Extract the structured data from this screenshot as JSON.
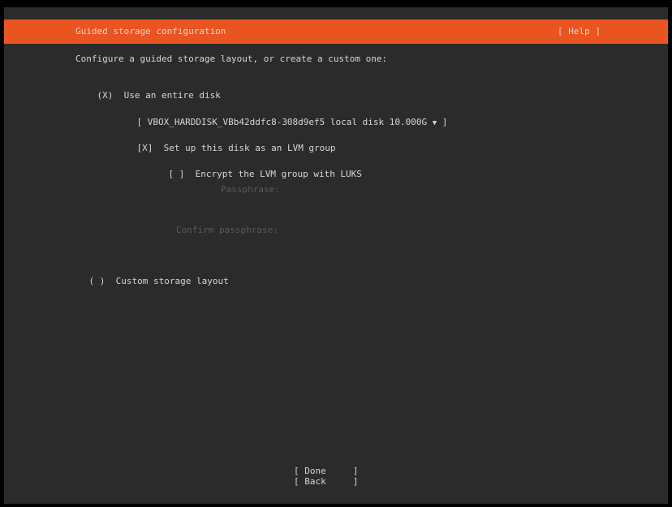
{
  "header": {
    "title": "Guided storage configuration",
    "help_label": "[ Help ]"
  },
  "intro": "Configure a guided storage layout, or create a custom one:",
  "entire_disk": {
    "radio": "(X)",
    "label": "Use an entire disk"
  },
  "disk_select": {
    "open_bracket": "[",
    "value": "VBOX_HARDDISK_VBb42ddfc8-308d9ef5 local disk 10.000G",
    "arrow": "▼",
    "close_bracket": "]"
  },
  "lvm": {
    "checkbox": "[X]",
    "label": "Set up this disk as an LVM group"
  },
  "encrypt": {
    "checkbox": "[ ]",
    "label": "Encrypt the LVM group with LUKS"
  },
  "passphrase": {
    "label": "Passphrase:"
  },
  "confirm_passphrase": {
    "label": "Confirm passphrase:"
  },
  "custom_layout": {
    "radio": "( )",
    "label": "Custom storage layout"
  },
  "buttons": {
    "done": "[ Done     ]",
    "back": "[ Back     ]"
  },
  "colors": {
    "header_bg": "#e95420",
    "screen_bg": "#2b2b2b",
    "text": "#d6d6d6",
    "disabled_text": "#5a5a5a"
  }
}
